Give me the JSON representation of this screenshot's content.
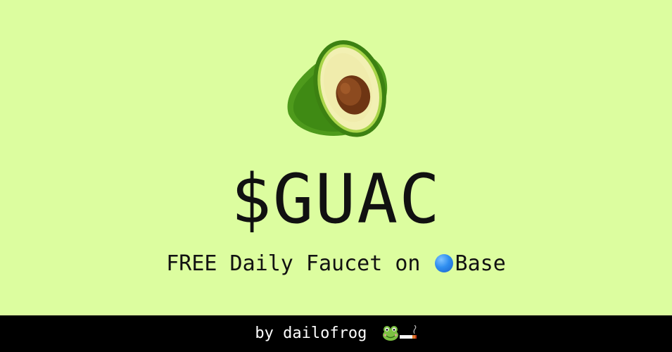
{
  "header": {
    "logo_icon": "avocado-icon"
  },
  "main": {
    "title": "$GUAC",
    "subtitle_text": "FREE Daily Faucet on ",
    "network_icon": "blue-circle-icon",
    "network_name": "Base"
  },
  "footer": {
    "credit": "by dailofrog",
    "icons": [
      "frog-face-icon",
      "cigarette-icon"
    ]
  },
  "colors": {
    "background": "#dcfd9f",
    "text": "#111111",
    "footer_bg": "#000000",
    "footer_text": "#ffffff",
    "base_blue": "#2f8ef0"
  }
}
